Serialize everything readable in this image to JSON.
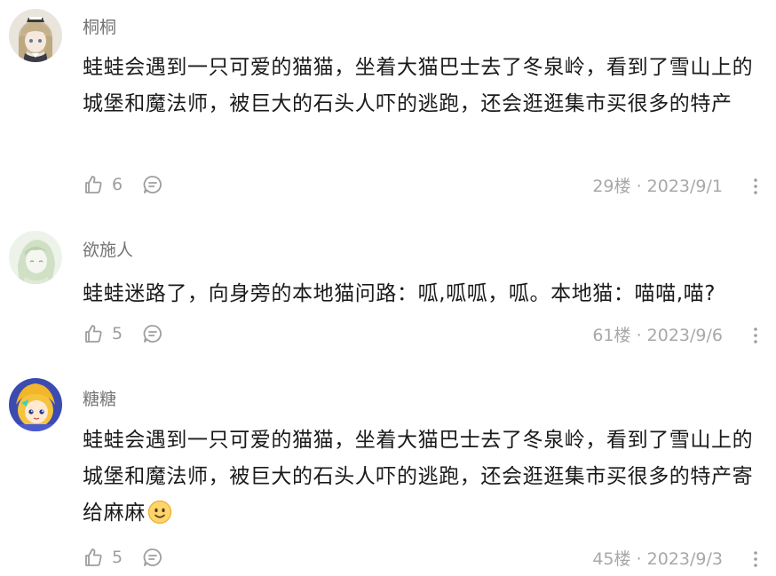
{
  "comments": [
    {
      "username": "桐桐",
      "avatar_icon": "anime-girl-avatar",
      "text": "蛙蛙会遇到一只可爱的猫猫，坐着大猫巴士去了冬泉岭，看到了雪山上的城堡和魔法师，被巨大的石头人吓的逃跑，还会逛逛集市买很多的特产",
      "likes": "6",
      "floor": "29楼",
      "separator": "·",
      "date": "2023/9/1"
    },
    {
      "username": "欲施人",
      "avatar_icon": "pale-green-portrait-avatar",
      "text": "蛙蛙迷路了，向身旁的本地猫问路：呱,呱呱，呱。本地猫：喵喵,喵?",
      "likes": "5",
      "floor": "61楼",
      "separator": "·",
      "date": "2023/9/6"
    },
    {
      "username": "糖糖",
      "avatar_icon": "blue-anime-character-avatar",
      "text": "蛙蛙会遇到一只可爱的猫猫，坐着大猫巴士去了冬泉岭，看到了雪山上的城堡和魔法师，被巨大的石头人吓的逃跑，还会逛逛集市买很多的特产寄给麻麻",
      "emoji": "smile-emoji",
      "likes": "5",
      "floor": "45楼",
      "separator": "·",
      "date": "2023/9/3"
    }
  ],
  "icons": {
    "like": "thumbs-up-icon",
    "reply": "comment-bubble-icon",
    "more": "more-vertical-icon"
  },
  "colors": {
    "username": "#757575",
    "text": "#1a1a1a",
    "meta": "#a8a8a8",
    "icon": "#9e9e9e"
  }
}
